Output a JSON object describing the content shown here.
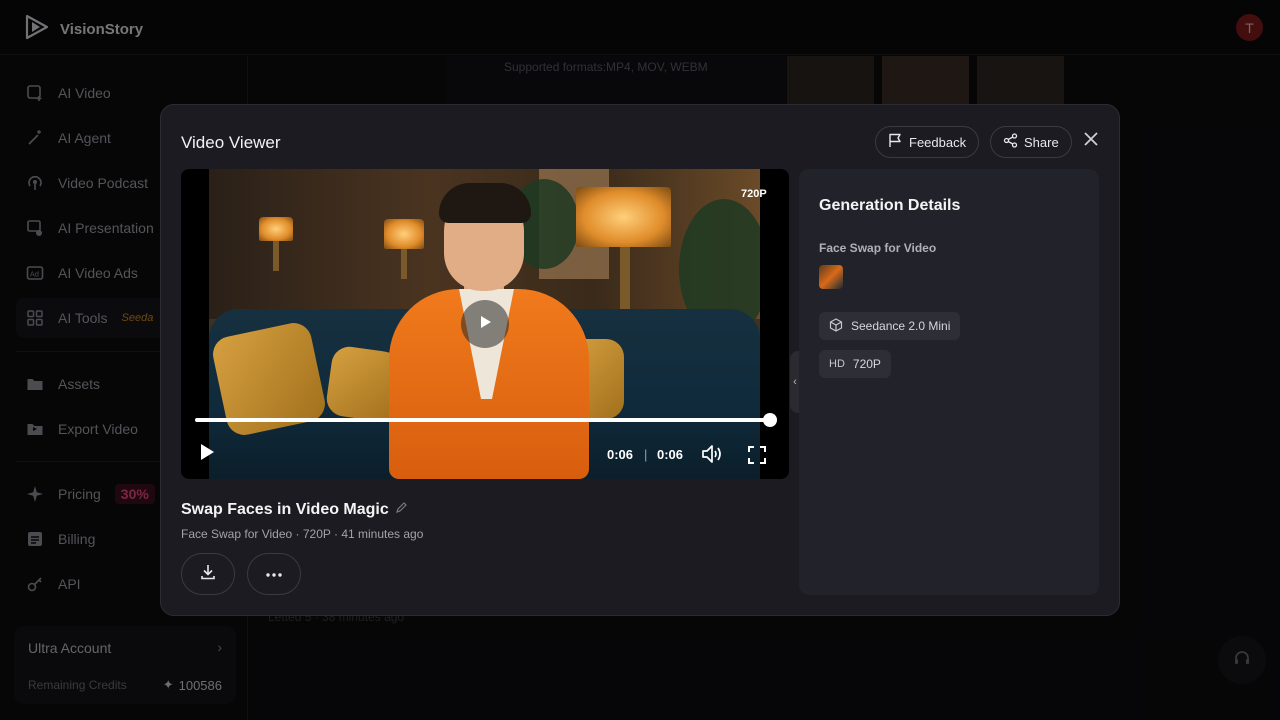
{
  "app": {
    "name": "VisionStory",
    "avatar_initial": "T"
  },
  "sidebar": {
    "items": [
      {
        "label": "AI Video",
        "icon": "video-plus-icon"
      },
      {
        "label": "AI Agent",
        "icon": "magic-wand-icon"
      },
      {
        "label": "Video Podcast",
        "icon": "podcast-icon"
      },
      {
        "label": "AI Presentation",
        "icon": "presentation-icon"
      },
      {
        "label": "AI Video Ads",
        "icon": "ads-icon"
      },
      {
        "label": "AI Tools",
        "icon": "grid-icon",
        "badge": "Seeda"
      },
      {
        "label": "Assets",
        "icon": "folder-icon"
      },
      {
        "label": "Export Video",
        "icon": "export-folder-icon"
      },
      {
        "label": "Pricing",
        "icon": "sparkle-icon",
        "badge": "30%"
      },
      {
        "label": "Billing",
        "icon": "receipt-icon"
      },
      {
        "label": "API",
        "icon": "key-icon"
      }
    ],
    "account": {
      "title": "Ultra Account",
      "credits_label": "Remaining Credits",
      "credits_value": "100586"
    }
  },
  "background": {
    "formats_text": "Supported formats:MP4, MOV, WEBM",
    "caption_text": "Letted 5 · 38 minutes ago"
  },
  "modal": {
    "title": "Video Viewer",
    "feedback_label": "Feedback",
    "share_label": "Share",
    "player": {
      "resolution_tag": "720P",
      "current_time": "0:06",
      "duration": "0:06",
      "progress": 1.0
    },
    "video": {
      "title": "Swap Faces in Video Magic",
      "meta": "Face Swap for Video · 720P · 41 minutes ago"
    },
    "details": {
      "heading": "Generation Details",
      "tool": "Face Swap for Video",
      "model": "Seedance 2.0 Mini",
      "quality_badge": "HD",
      "quality": "720P"
    }
  },
  "colors": {
    "accent_orange": "#f07a1c",
    "panel": "#1b1b21",
    "details_panel": "#22222a"
  }
}
